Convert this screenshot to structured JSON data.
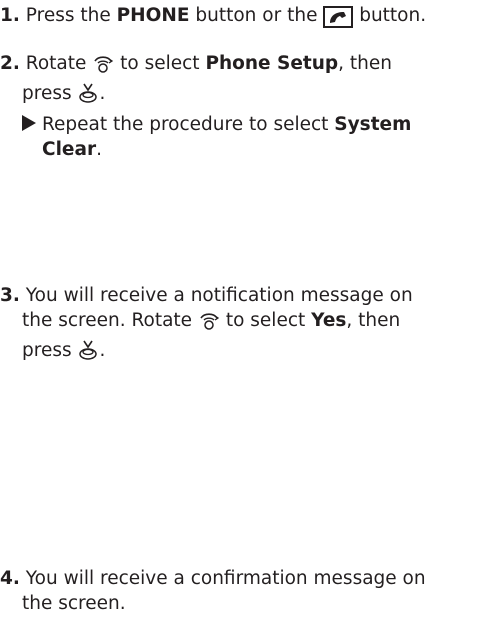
{
  "steps": [
    {
      "num": "1.",
      "t1": "Press the ",
      "b1": "PHONE",
      "t2": " button or the ",
      "t3": " button.",
      "icon": "phone-handset-icon"
    },
    {
      "num": "2.",
      "t1": "Rotate ",
      "t2": " to select ",
      "b1": "Phone Setup",
      "t3": ", then",
      "t4": "press ",
      "t5": ".",
      "sub_t1": "Repeat the procedure to select ",
      "sub_b1": "System",
      "sub_b2": "Clear",
      "sub_t2": "."
    },
    {
      "num": "3.",
      "l1": "You will receive a notification message on",
      "l2a": "the screen. Rotate ",
      "l2b": " to select ",
      "l2c": "Yes",
      "l2d": ", then",
      "l3a": "press ",
      "l3b": "."
    },
    {
      "num": "4.",
      "l1": "You will receive a confirmation message on",
      "l2": "the screen."
    }
  ]
}
